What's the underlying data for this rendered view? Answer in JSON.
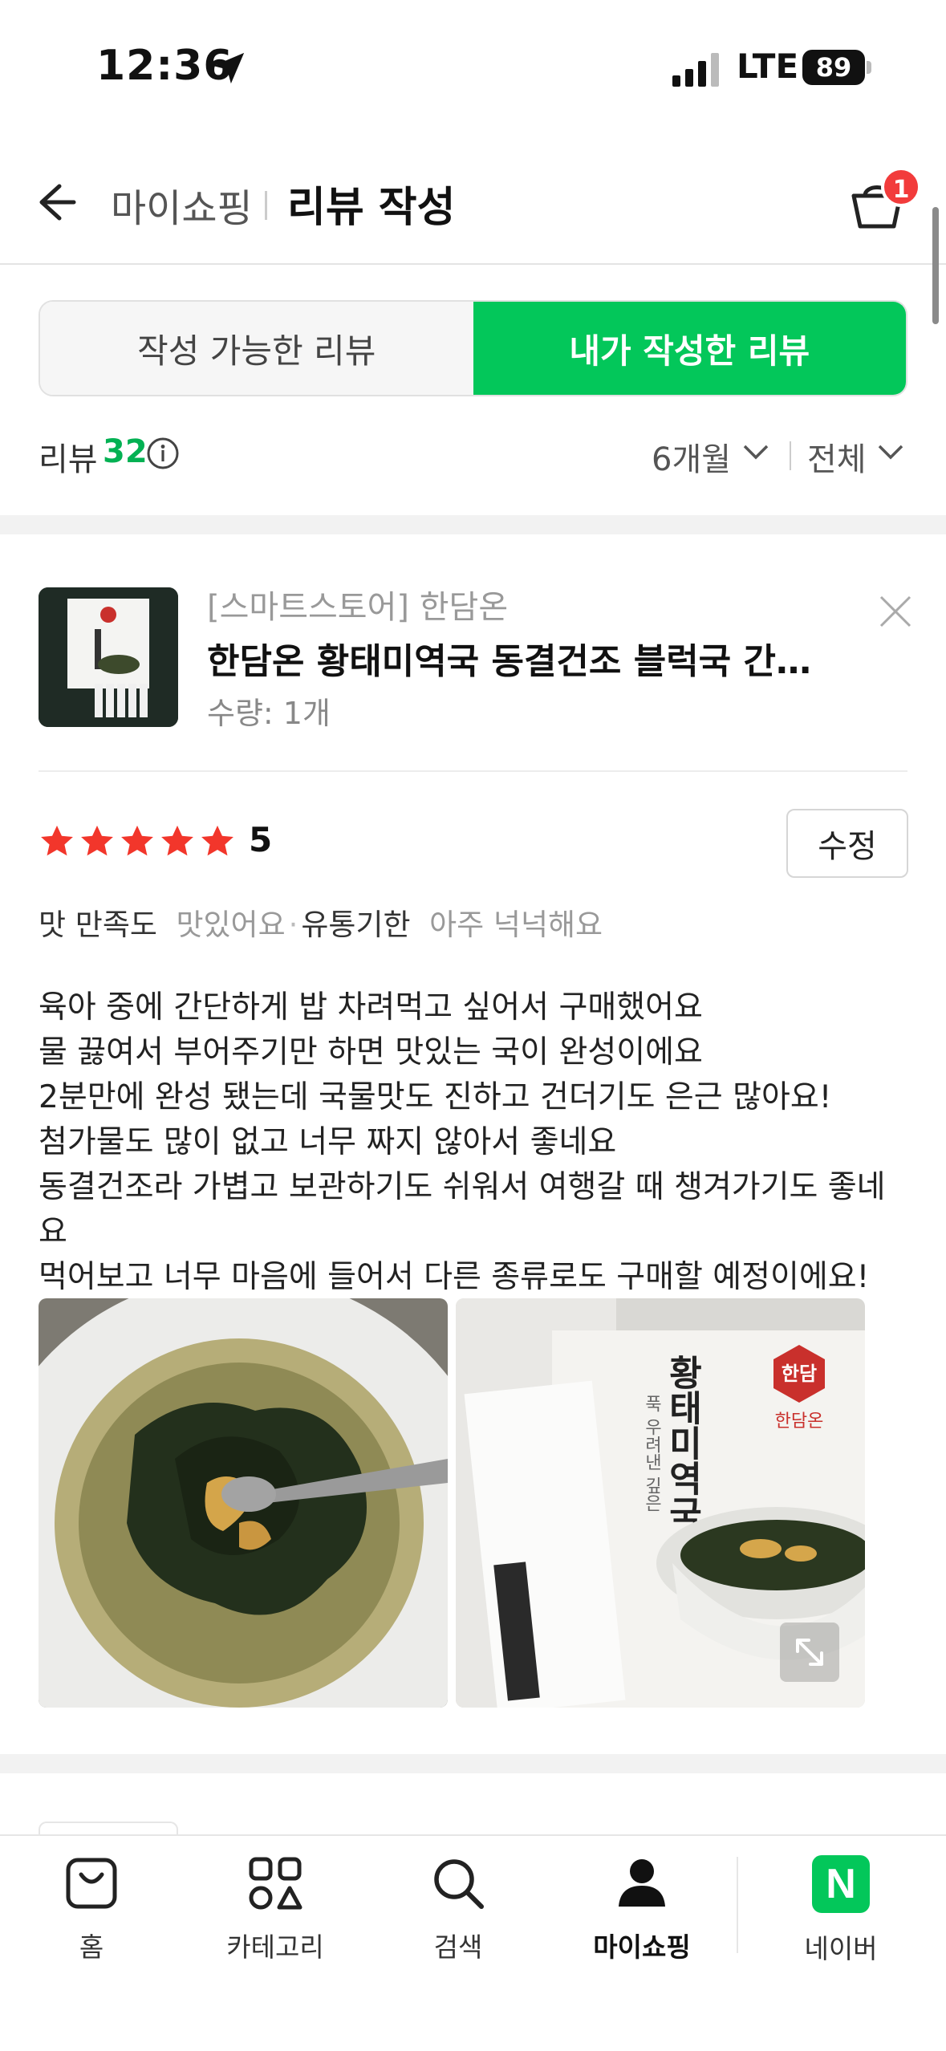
{
  "status_bar": {
    "time": "12:36",
    "network": "LTE",
    "battery": "89"
  },
  "header": {
    "breadcrumb": "마이쇼핑",
    "title": "리뷰 작성",
    "cart_count": "1"
  },
  "tabs": [
    {
      "label": "작성 가능한 리뷰",
      "active": false
    },
    {
      "label": "내가 작성한 리뷰",
      "active": true
    }
  ],
  "filter": {
    "review_label": "리뷰",
    "review_count": "32",
    "period": "6개월",
    "scope": "전체"
  },
  "review": {
    "store": "[스마트스토어] 한담온",
    "product_name": "한담온 황태미역국 동결건조 블럭국 간편...",
    "quantity": "수량: 1개",
    "rating": "5",
    "rating_value": 5,
    "edit_label": "수정",
    "attributes": [
      {
        "key": "맛 만족도",
        "value": "맛있어요"
      },
      {
        "key": "유통기한",
        "value": "아주 넉넉해요"
      }
    ],
    "body_lines": [
      "육아 중에 간단하게 밥 차려먹고 싶어서 구매했어요",
      "물 끓여서 부어주기만 하면 맛있는 국이 완성이에요",
      "2분만에 완성 됐는데 국물맛도 진하고 건더기도 은근 많아요!",
      "첨가물도 많이 없고 너무 짜지 않아서 좋네요",
      "동결건조라 가볍고 보관하기도 쉬워서 여행갈 때 챙겨가기도 좋네요",
      "먹어보고 너무 마음에 들어서 다른 종류로도 구매할 예정이에요!"
    ],
    "package_text": "푹 우려낸 깊은",
    "package_title": "황태미역국",
    "package_brand": "한담온",
    "package_logo": "한담"
  },
  "bottom_nav": [
    {
      "label": "홈",
      "icon": "bag-icon",
      "active": false
    },
    {
      "label": "카테고리",
      "icon": "category-icon",
      "active": false
    },
    {
      "label": "검색",
      "icon": "search-icon",
      "active": false
    },
    {
      "label": "마이쇼핑",
      "icon": "person-icon",
      "active": true
    },
    {
      "label": "네이버",
      "icon": "naver-icon",
      "active": false
    }
  ],
  "naver_letter": "N",
  "colors": {
    "accent": "#03c75a",
    "badge": "#f23b3b",
    "star": "#f2362b"
  }
}
